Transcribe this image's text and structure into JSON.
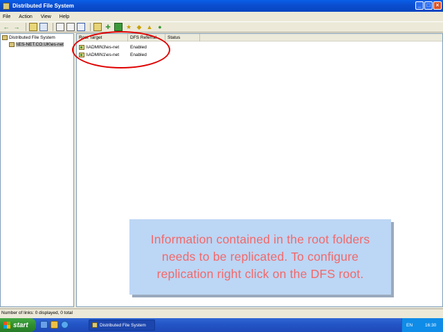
{
  "window": {
    "title": "Distributed File System"
  },
  "menu": [
    "File",
    "Action",
    "View",
    "Help"
  ],
  "toolbar_icons": [
    "back-arrow-icon",
    "forward-arrow-icon",
    "up-folder-icon",
    "properties-icon",
    "refresh-icon",
    "export-icon",
    "help-icon",
    "new-root-icon",
    "new-link-icon",
    "open-icon",
    "check-status-icon",
    "filter-icon",
    "replication-icon",
    "show-hide-icon"
  ],
  "tree": {
    "root": "Distributed File System",
    "child": "\\\\ES-NET.CO.UK\\es-net"
  },
  "list": {
    "columns": [
      "Root Target",
      "DFS Referral",
      "Status"
    ],
    "rows": [
      {
        "target": "\\\\ADMIN3\\es-net",
        "referral": "Enabled",
        "status": ""
      },
      {
        "target": "\\\\ADMIN1\\es-net",
        "referral": "Enabled",
        "status": ""
      }
    ]
  },
  "callout": {
    "text": "Information contained in the root folders needs to be replicated. To configure replication right click on the DFS root."
  },
  "status_bar": "Number of links: 0 displayed, 0 total",
  "taskbar": {
    "start": "start",
    "task": "Distributed File System",
    "lang": "EN",
    "clock": "16:30"
  }
}
